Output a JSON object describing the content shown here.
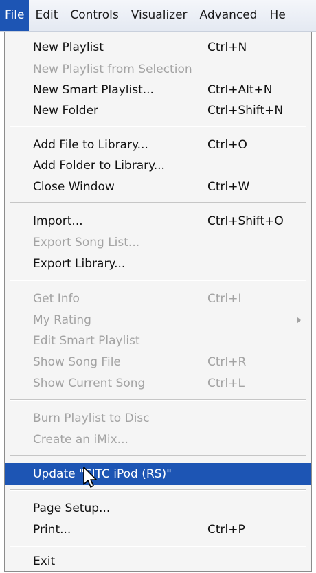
{
  "menubar": {
    "items": [
      "File",
      "Edit",
      "Controls",
      "Visualizer",
      "Advanced",
      "He"
    ]
  },
  "menu": {
    "items": [
      {
        "label": "New Playlist",
        "shortcut": "Ctrl+N",
        "enabled": true
      },
      {
        "label": "New Playlist from Selection",
        "shortcut": "",
        "enabled": false
      },
      {
        "label": "New Smart Playlist...",
        "shortcut": "Ctrl+Alt+N",
        "enabled": true
      },
      {
        "label": "New Folder",
        "shortcut": "Ctrl+Shift+N",
        "enabled": true
      },
      {
        "label": "Add File to Library...",
        "shortcut": "Ctrl+O",
        "enabled": true
      },
      {
        "label": "Add Folder to Library...",
        "shortcut": "",
        "enabled": true
      },
      {
        "label": "Close Window",
        "shortcut": "Ctrl+W",
        "enabled": true
      },
      {
        "label": "Import...",
        "shortcut": "Ctrl+Shift+O",
        "enabled": true
      },
      {
        "label": "Export Song List...",
        "shortcut": "",
        "enabled": false
      },
      {
        "label": "Export Library...",
        "shortcut": "",
        "enabled": true
      },
      {
        "label": "Get Info",
        "shortcut": "Ctrl+I",
        "enabled": false
      },
      {
        "label": "My Rating",
        "shortcut": "",
        "enabled": false
      },
      {
        "label": "Edit Smart Playlist",
        "shortcut": "",
        "enabled": false
      },
      {
        "label": "Show Song File",
        "shortcut": "Ctrl+R",
        "enabled": false
      },
      {
        "label": "Show Current Song",
        "shortcut": "Ctrl+L",
        "enabled": false
      },
      {
        "label": "Burn Playlist to Disc",
        "shortcut": "",
        "enabled": false
      },
      {
        "label": "Create an iMix...",
        "shortcut": "",
        "enabled": false
      },
      {
        "label": "Update \"SITC iPod (RS)\"",
        "shortcut": "",
        "enabled": true,
        "selected": true
      },
      {
        "label": "Page Setup...",
        "shortcut": "",
        "enabled": true
      },
      {
        "label": "Print...",
        "shortcut": "Ctrl+P",
        "enabled": true
      },
      {
        "label": "Exit",
        "shortcut": "",
        "enabled": true
      }
    ]
  },
  "icons": {
    "submenu": "chevron-right-icon",
    "cursor": "mouse-pointer-icon"
  },
  "colors": {
    "highlight": "#1d55b4",
    "disabled_text": "#a3a3a3",
    "menu_bg": "#f5f5f5"
  }
}
